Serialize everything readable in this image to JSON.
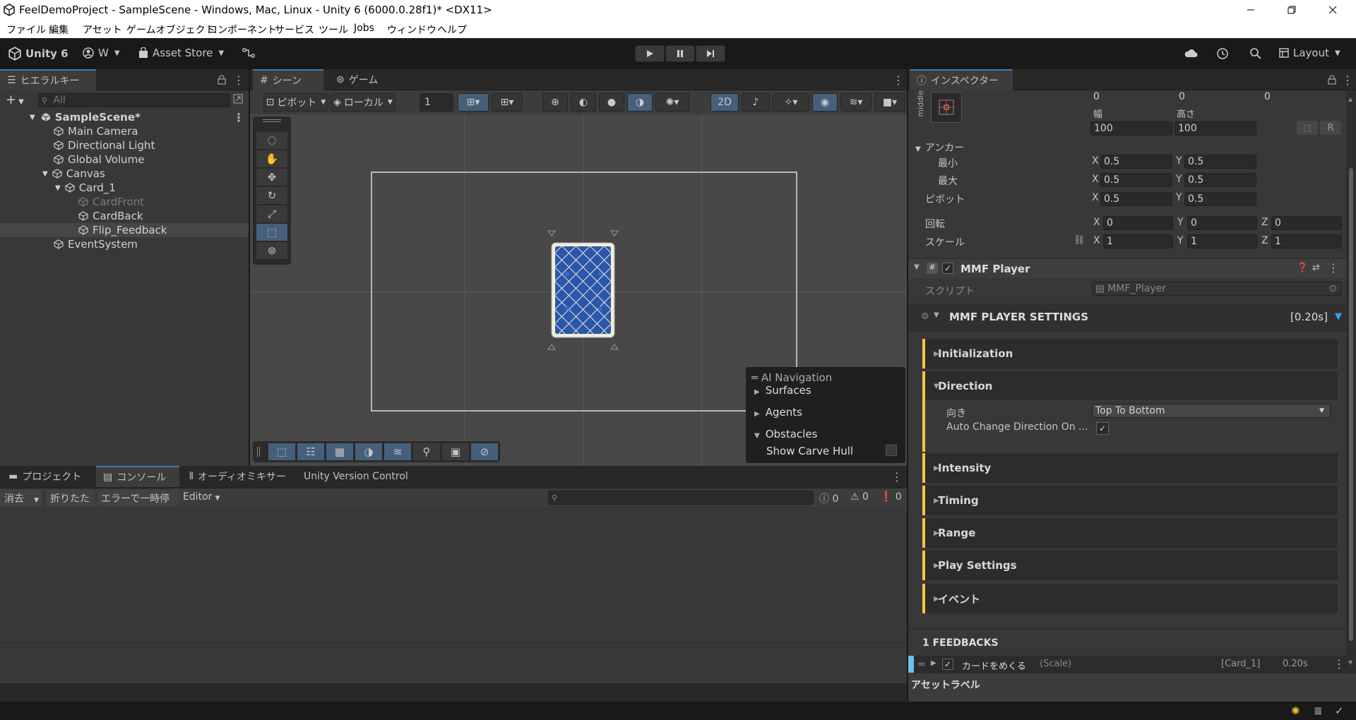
{
  "window": {
    "title": "FeelDemoProject - SampleScene - Windows, Mac, Linux - Unity 6 (6000.0.28f1)* <DX11>"
  },
  "menu": [
    "ファイル",
    "編集",
    "アセット",
    "ゲームオブジェクト",
    "コンポーネント",
    "サービス",
    "ツール",
    "Jobs",
    "ウィンドウ",
    "ヘルプ"
  ],
  "toolbar": {
    "unity": "Unity 6",
    "account": "W",
    "asset_store": "Asset Store",
    "layout": "Layout"
  },
  "hierarchy": {
    "tab": "ヒエラルキー",
    "search_placeholder": "All",
    "items": [
      "SampleScene*",
      "Main Camera",
      "Directional Light",
      "Global Volume",
      "Canvas",
      "Card_1",
      "CardFront",
      "CardBack",
      "Flip_Feedback",
      "EventSystem"
    ]
  },
  "scene": {
    "tabs": [
      "シーン",
      "ゲーム"
    ],
    "pivot": "ピボット",
    "local": "ローカル",
    "grid_value": "1",
    "mode_2d": "2D",
    "ai_nav": {
      "title": "AI Navigation",
      "items": [
        "Surfaces",
        "Agents",
        "Obstacles"
      ],
      "show_carve": "Show Carve Hull"
    }
  },
  "bottom": {
    "tabs": [
      "プロジェクト",
      "コンソール",
      "オーディオミキサー",
      "Unity Version Control"
    ],
    "buttons": [
      "消去",
      "折りたたむ",
      "エラーで一時停止",
      "Editor"
    ],
    "counts": [
      "0",
      "0",
      "0"
    ]
  },
  "inspector": {
    "tab": "インスペクター",
    "anchor_preset": "middle",
    "pos": [
      "0",
      "0",
      "0"
    ],
    "width_label": "幅",
    "height_label": "高さ",
    "width": "100",
    "height": "100",
    "anchors_label": "アンカー",
    "min_label": "最小",
    "max_label": "最大",
    "pivot_label": "ピボット",
    "rotation_label": "回転",
    "scale_label": "スケール",
    "x": "X",
    "y": "Y",
    "z": "Z",
    "r": "R",
    "anchor_min": [
      "0.5",
      "0.5"
    ],
    "anchor_max": [
      "0.5",
      "0.5"
    ],
    "pivot": [
      "0.5",
      "0.5"
    ],
    "rotation": [
      "0",
      "0",
      "0"
    ],
    "scale": [
      "1",
      "1",
      "1"
    ],
    "component": "MMF Player",
    "script_label": "スクリプト",
    "script": "MMF_Player",
    "settings": "MMF PLAYER SETTINGS",
    "duration": "[0.20s]",
    "sections": [
      "Initialization",
      "Direction",
      "Intensity",
      "Timing",
      "Range",
      "Play Settings",
      "イベント"
    ],
    "direction_label": "向き",
    "direction_value": "Top To Bottom",
    "auto_change": "Auto Change Direction On ...",
    "feedbacks_header": "1 FEEDBACKS",
    "feedback": {
      "name": "カードをめくる",
      "type": "(Scale)",
      "target": "[Card_1]",
      "time": "0.20s"
    },
    "asset_label": "アセットラベル",
    "accent": "#f2c744"
  }
}
